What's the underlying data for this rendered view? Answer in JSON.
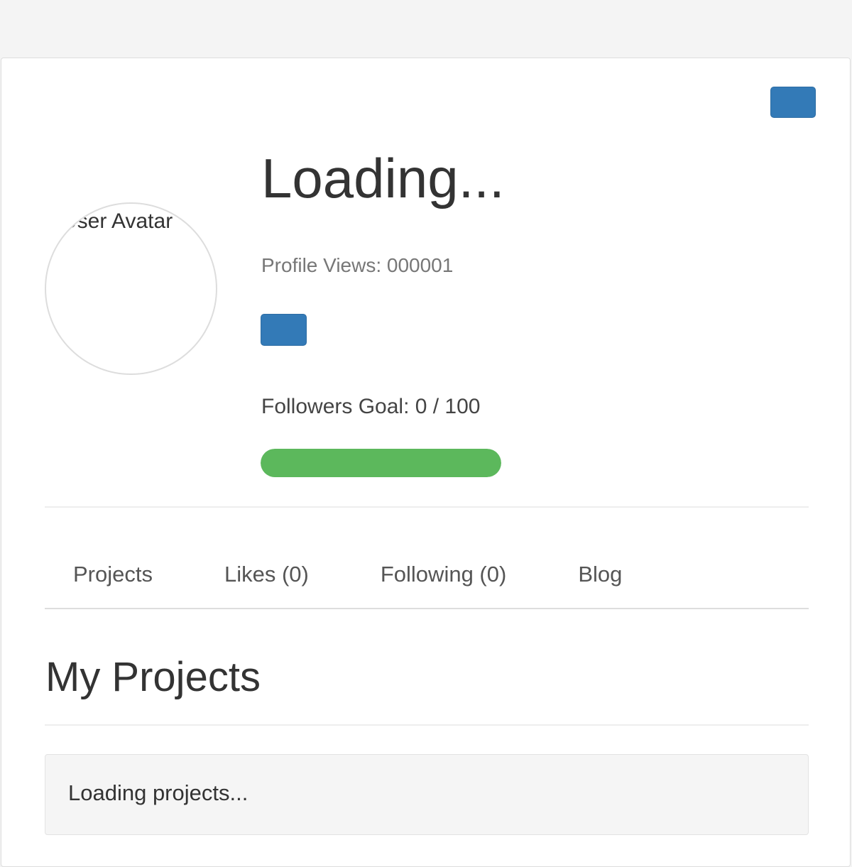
{
  "profile": {
    "name": "Loading...",
    "avatar_alt": "User Avatar",
    "views_label": "Profile Views: 000001",
    "followers_goal_label": "Followers Goal: 0 / 100",
    "followers_progress_fraction": 1.0
  },
  "tabs": [
    {
      "label": "Projects"
    },
    {
      "label": "Likes (0)"
    },
    {
      "label": "Following (0)"
    },
    {
      "label": "Blog"
    }
  ],
  "section": {
    "title": "My Projects",
    "loading_text": "Loading projects..."
  },
  "colors": {
    "button_primary": "#337ab7",
    "progress_success": "#5cb85c"
  }
}
